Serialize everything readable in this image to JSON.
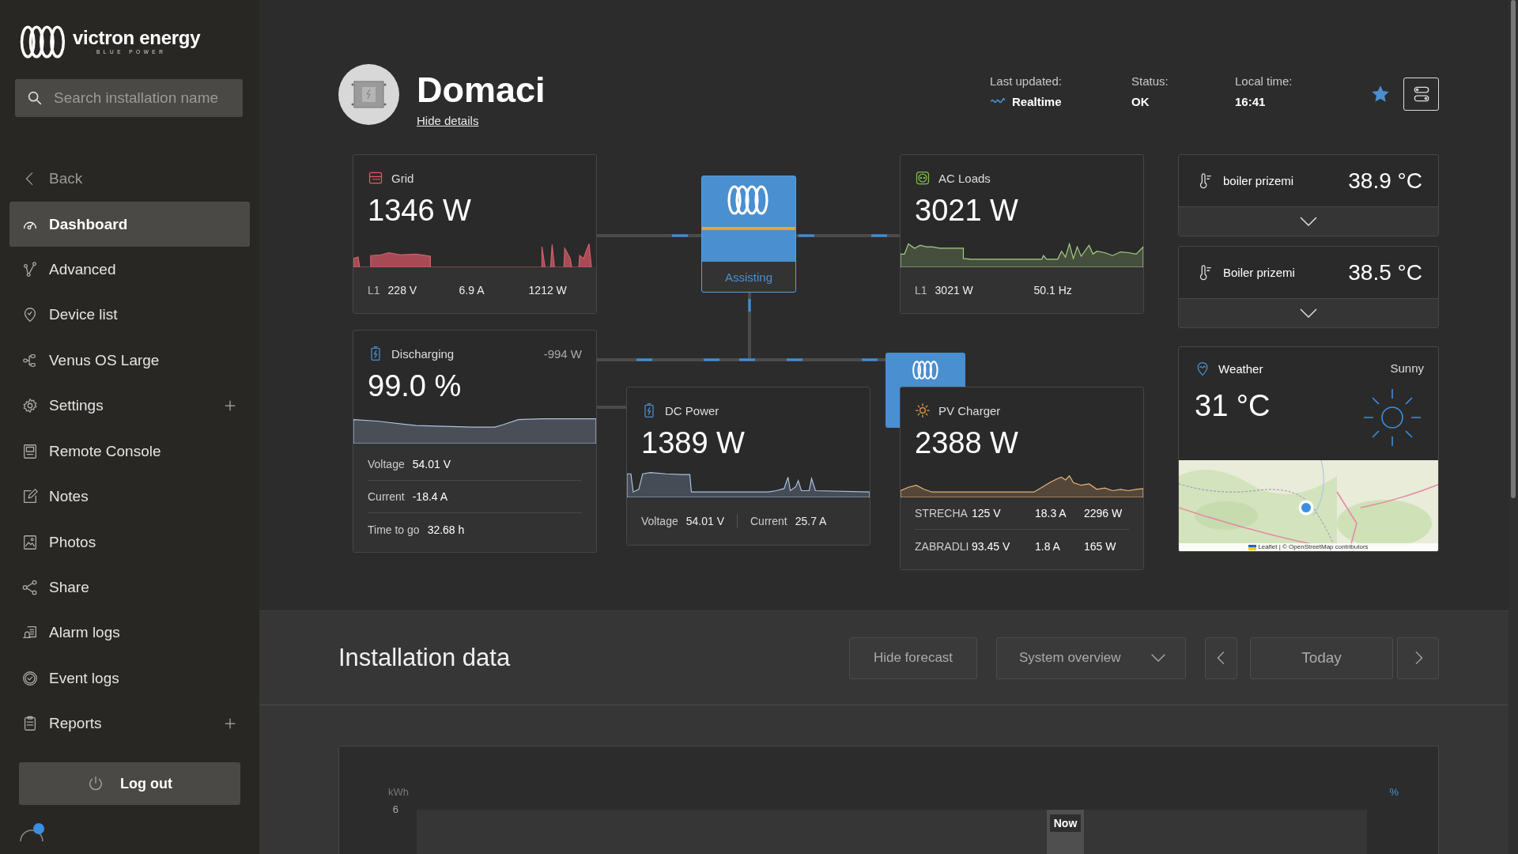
{
  "brand": {
    "name": "victron energy",
    "tagline": "BLUE POWER"
  },
  "search": {
    "placeholder": "Search installation name"
  },
  "back": "Back",
  "nav": [
    {
      "label": "Dashboard",
      "selected": true,
      "expandable": false
    },
    {
      "label": "Advanced",
      "selected": false,
      "expandable": false
    },
    {
      "label": "Device list",
      "selected": false,
      "expandable": false
    },
    {
      "label": "Venus OS Large",
      "selected": false,
      "expandable": false
    },
    {
      "label": "Settings",
      "selected": false,
      "expandable": true
    },
    {
      "label": "Remote Console",
      "selected": false,
      "expandable": false
    },
    {
      "label": "Notes",
      "selected": false,
      "expandable": false
    },
    {
      "label": "Photos",
      "selected": false,
      "expandable": false
    },
    {
      "label": "Share",
      "selected": false,
      "expandable": false
    },
    {
      "label": "Alarm logs",
      "selected": false,
      "expandable": false
    },
    {
      "label": "Event logs",
      "selected": false,
      "expandable": false
    },
    {
      "label": "Reports",
      "selected": false,
      "expandable": true
    }
  ],
  "logout": "Log out",
  "installation": {
    "name": "Domaci",
    "details_link": "Hide details"
  },
  "meta": [
    {
      "label": "Last updated:",
      "value": "Realtime",
      "kind": "realtime"
    },
    {
      "label": "Status:",
      "value": "OK",
      "kind": "plain"
    },
    {
      "label": "Local time:",
      "value": "16:41",
      "kind": "plain"
    }
  ],
  "favorite": true,
  "grid": {
    "title": "Grid",
    "value": "1346 W",
    "phase": "L1",
    "readings": [
      "228 V",
      "6.9 A",
      "1212 W"
    ]
  },
  "inverter": {
    "state": "Assisting"
  },
  "ac_loads": {
    "title": "AC Loads",
    "value": "3021 W",
    "phase": "L1",
    "readings": [
      "3021 W",
      "50.1 Hz"
    ]
  },
  "battery": {
    "title": "Discharging",
    "power": "-994 W",
    "value": "99.0 %",
    "rows": [
      {
        "label": "Voltage",
        "value": "54.01 V"
      },
      {
        "label": "Current",
        "value": "-18.4 A"
      },
      {
        "label": "Time to go",
        "value": "32.68 h"
      }
    ]
  },
  "dc_power": {
    "title": "DC Power",
    "value": "1389 W",
    "readings": [
      {
        "label": "Voltage",
        "value": "54.01 V"
      },
      {
        "label": "Current",
        "value": "25.7 A"
      }
    ]
  },
  "pv_charger": {
    "title": "PV Charger",
    "value": "2388 W",
    "trackers": [
      {
        "name": "STRECHA",
        "voltage": "125 V",
        "current": "18.3 A",
        "power": "2296 W"
      },
      {
        "name": "ZABRADLI",
        "voltage": "93.45 V",
        "current": "1.8 A",
        "power": "165 W"
      }
    ]
  },
  "temperatures": [
    {
      "name": "boiler prizemi",
      "value": "38.9 °C",
      "expanded": false
    },
    {
      "name": "Boiler prizemi",
      "value": "38.5 °C",
      "expanded": false
    }
  ],
  "weather": {
    "title": "Weather",
    "condition": "Sunny",
    "temperature": "31 °C",
    "map": {
      "kind": "picture",
      "attribution": "Leaflet | © OpenStreetMap contributors"
    }
  },
  "installation_data": {
    "title": "Installation data",
    "forecast_button": "Hide forecast",
    "view_select": "System overview",
    "date": "Today",
    "chart": {
      "y_unit": "kWh",
      "y2_unit": "%",
      "y_tick": "6",
      "now_label": "Now"
    }
  }
}
